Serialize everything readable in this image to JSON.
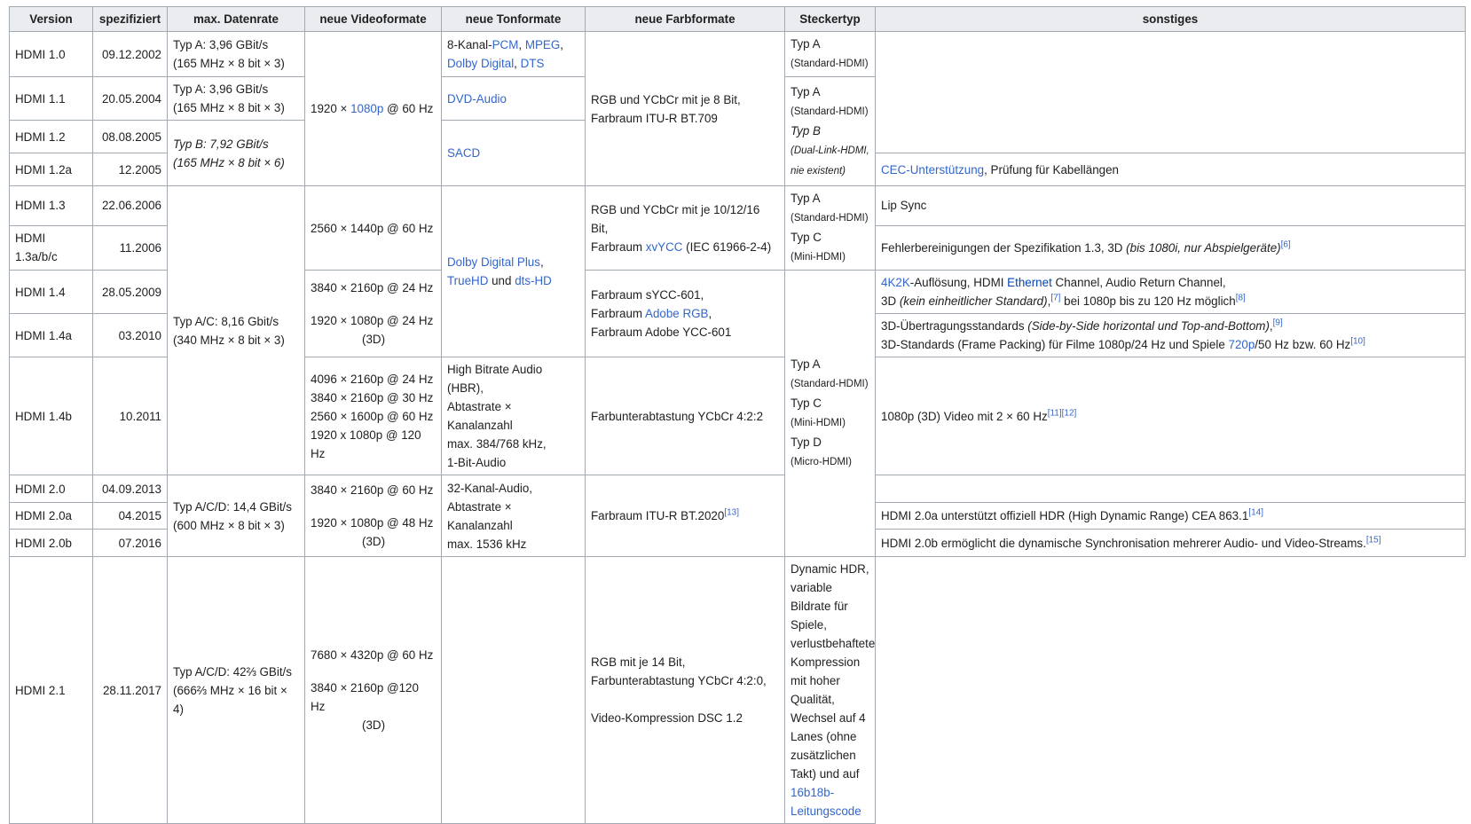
{
  "headers": [
    "Version",
    "spezifiziert",
    "max. Datenrate",
    "neue Videoformate",
    "neue Tonformate",
    "neue Farbformate",
    "Steckertyp",
    "sonstiges"
  ],
  "versions": [
    {
      "version": "HDMI 1.0",
      "date": "09.12.2002"
    },
    {
      "version": "HDMI 1.1",
      "date": "20.05.2004"
    },
    {
      "version": "HDMI 1.2",
      "date": "08.08.2005"
    },
    {
      "version": "HDMI 1.2a",
      "date": "12.2005"
    },
    {
      "version": "HDMI 1.3",
      "date": "22.06.2006"
    },
    {
      "version": "HDMI 1.3a/b/c",
      "date": "11.2006"
    },
    {
      "version": "HDMI 1.4",
      "date": "28.05.2009"
    },
    {
      "version": "HDMI 1.4a",
      "date": "03.2010"
    },
    {
      "version": "HDMI 1.4b",
      "date": "10.2011"
    },
    {
      "version": "HDMI 2.0",
      "date": "04.09.2013"
    },
    {
      "version": "HDMI 2.0a",
      "date": "04.2015"
    },
    {
      "version": "HDMI 2.0b",
      "date": "07.2016"
    },
    {
      "version": "HDMI 2.1",
      "date": "28.11.2017"
    }
  ],
  "rate": {
    "r10": [
      "Typ A: 3,96 GBit/s",
      "(165 MHz × 8 bit × 3)"
    ],
    "r11": [
      "Typ A: 3,96 GBit/s",
      "(165 MHz × 8 bit × 3)"
    ],
    "r12": [
      "Typ B: 7,92 GBit/s",
      "(165 MHz × 8 bit × 6)"
    ],
    "r13": [
      "Typ A/C: 8,16 Gbit/s",
      "(340 MHz × 8 bit × 3)"
    ],
    "r20": [
      "Typ A/C/D: 14,4 GBit/s",
      "(600 MHz × 8 bit × 3)"
    ],
    "r21": [
      "Typ A/C/D: 42⅔ GBit/s",
      "(666⅔ MHz × 16 bit × 4)"
    ]
  },
  "video": {
    "v10": {
      "a": "1920 × ",
      "link": "1080p",
      "b": " @ 60 Hz"
    },
    "v13": "2560 × 1440p @ 60 Hz",
    "v14": [
      "3840 × 2160p @ 24 Hz",
      "1920 × 1080p @ 24 Hz",
      "(3D)"
    ],
    "v14b": [
      "4096 × 2160p @ 24 Hz",
      "3840 × 2160p @ 30 Hz",
      "2560 × 1600p @ 60 Hz",
      "1920 x 1080p @ 120 Hz"
    ],
    "v20": [
      "3840 × 2160p @ 60 Hz",
      "1920 × 1080p @ 48 Hz",
      "(3D)"
    ],
    "v21": [
      "7680 × 4320p @ 60 Hz",
      "3840 × 2160p @120 Hz",
      "(3D)"
    ]
  },
  "audio": {
    "a10": {
      "pre": "8-Kanal-",
      "pcm": "PCM",
      "sep": ", ",
      "mpeg": "MPEG",
      ",": ",",
      "dd": "Dolby Digital",
      "sep2": ", ",
      "dts": "DTS"
    },
    "a11": "DVD-Audio",
    "a12": "SACD",
    "a13": {
      "ddp": "Dolby Digital Plus",
      "c": ",",
      "truehd": "TrueHD",
      "und": " und ",
      "dtshd": "dts-HD"
    },
    "a14b": [
      "High Bitrate Audio (HBR),",
      "Abtastrate × Kanalanzahl",
      "max. 384/768 kHz,",
      "1-Bit-Audio"
    ],
    "a20": [
      "32-Kanal-Audio,",
      "Abtastrate × Kanalanzahl",
      "max. 1536 kHz"
    ]
  },
  "color": {
    "c10": [
      "RGB und YCbCr mit je 8 Bit,",
      "Farbraum ITU-R BT.709"
    ],
    "c13": {
      "l1": "RGB und YCbCr mit je 10/12/16 Bit,",
      "pre": "Farbraum ",
      "link": "xvYCC",
      "post": " (IEC 61966-2-4)"
    },
    "c14": {
      "l1": "Farbraum sYCC-601,",
      "pre": "Farbraum ",
      "link": "Adobe RGB",
      "post": ",",
      "l3": "Farbraum Adobe YCC-601"
    },
    "c14b": "Farbunterabtastung YCbCr 4:2:2",
    "c20": {
      "text": "Farbraum ITU-R BT.2020",
      "ref": "[13]"
    },
    "c21": [
      "RGB mit je 14 Bit,",
      "Farbunterabtastung YCbCr 4:2:0,",
      "Video-Kompression DSC 1.2"
    ]
  },
  "plug": {
    "p10": [
      "Typ A",
      "(Standard-HDMI)"
    ],
    "p11": [
      "Typ A",
      "(Standard-HDMI)",
      "Typ B",
      "(Dual-Link-HDMI,",
      "nie existent)"
    ],
    "p13": [
      "Typ A",
      "(Standard-HDMI)",
      "Typ C",
      "(Mini-HDMI)"
    ],
    "p14": [
      "Typ A",
      "(Standard-HDMI)",
      "Typ C",
      "(Mini-HDMI)",
      "Typ D",
      "(Micro-HDMI)"
    ]
  },
  "misc": {
    "m12a": {
      "link": "CEC-Unterstützung",
      "text": ", Prüfung für Kabellängen"
    },
    "m13": "Lip Sync",
    "m13a": {
      "text": "Fehlerbereinigungen der Spezifikation 1.3, 3D ",
      "it": "(bis 1080i, nur Abspielgeräte)",
      "ref": "[6]"
    },
    "m14": {
      "link": "4K2K",
      "t1": "-Auflösung, HDMI ",
      "eth": "Ethernet",
      "t2": " Channel, Audio Return Channel,",
      "t3": "3D ",
      "it": "(kein einheitlicher Standard)",
      "t4": ",",
      "ref7": "[7]",
      "t5": " bei 1080p bis zu 120 Hz möglich",
      "ref8": "[8]"
    },
    "m14a": {
      "t1": "3D-Übertragungsstandards ",
      "it": "(Side-by-Side horizontal und Top-and-Bottom)",
      "t2": ",",
      "ref9": "[9]",
      "t3": "3D-Standards (Frame Packing) für Filme 1080p/24 Hz und Spiele ",
      "link": "720p",
      "t4": "/50 Hz bzw. 60 Hz",
      "ref10": "[10]"
    },
    "m14b": {
      "text": "1080p (3D) Video mit 2 × 60 Hz",
      "ref11": "[11]",
      "ref12": "[12]"
    },
    "m20a": {
      "text": "HDMI 2.0a unterstützt offiziell HDR (High Dynamic Range) CEA 863.1",
      "ref": "[14]"
    },
    "m20b": {
      "text": "HDMI 2.0b ermöglicht die dynamische Synchronisation mehrerer Audio- und Video-Streams.",
      "ref": "[15]"
    },
    "m21": {
      "l1": "Dynamic HDR, variable Bildrate für Spiele, verlustbehaftete Kompression mit hoher Qualität,",
      "l2": "Wechsel auf 4 Lanes (ohne zusätzlichen Takt) und auf ",
      "link": "16b18b-Leitungscode"
    }
  }
}
